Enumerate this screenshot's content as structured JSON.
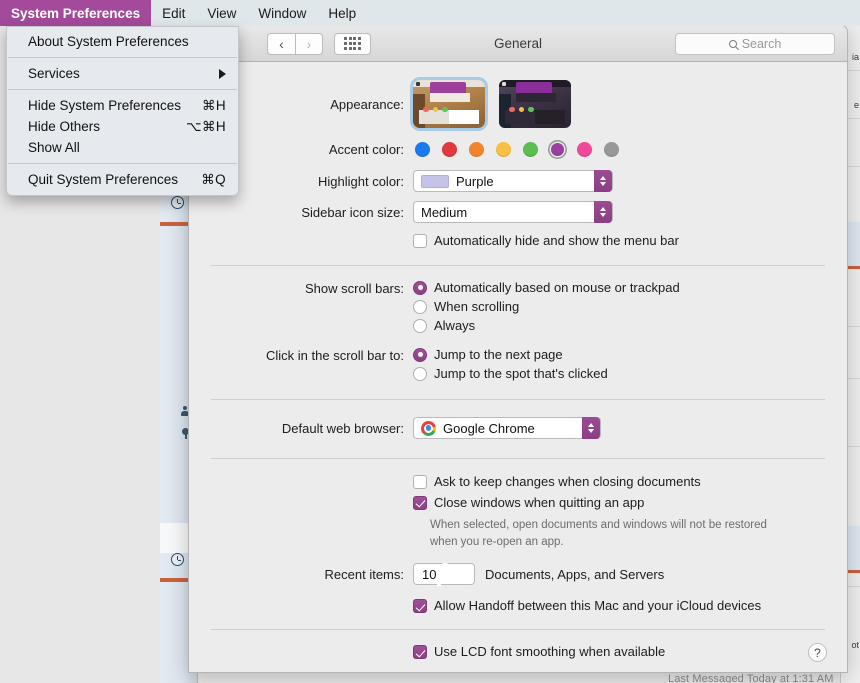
{
  "menubar": {
    "items": [
      {
        "label": "System Preferences",
        "active": true,
        "bold": true
      },
      {
        "label": "Edit",
        "active": false,
        "bold": false
      },
      {
        "label": "View",
        "active": false,
        "bold": false
      },
      {
        "label": "Window",
        "active": false,
        "bold": false
      },
      {
        "label": "Help",
        "active": false,
        "bold": false
      }
    ],
    "highlight_color": "#a34a9a"
  },
  "dropdown": {
    "about": "About System Preferences",
    "services": "Services",
    "hide_app": "Hide System Preferences",
    "hide_app_shortcut": "⌘H",
    "hide_others": "Hide Others",
    "hide_others_shortcut": "⌥⌘H",
    "show_all": "Show All",
    "quit": "Quit System Preferences",
    "quit_shortcut": "⌘Q"
  },
  "toolbar": {
    "title": "General",
    "back_glyph": "‹",
    "forward_glyph": "›",
    "search_placeholder": "Search",
    "search_value": ""
  },
  "general": {
    "appearance_label": "Appearance:",
    "appearance_options": [
      {
        "name": "Light",
        "selected": true
      },
      {
        "name": "Dark",
        "selected": false
      }
    ],
    "accent_label": "Accent color:",
    "accent_colors": [
      {
        "name": "Blue",
        "hex": "#1a7af0",
        "selected": false
      },
      {
        "name": "Red",
        "hex": "#e0393e",
        "selected": false
      },
      {
        "name": "Orange",
        "hex": "#f2842c",
        "selected": false
      },
      {
        "name": "Yellow",
        "hex": "#f6c044",
        "selected": false
      },
      {
        "name": "Green",
        "hex": "#5bbf4f",
        "selected": false
      },
      {
        "name": "Purple",
        "hex": "#9a3fa0",
        "selected": true
      },
      {
        "name": "Pink",
        "hex": "#f0499a",
        "selected": false
      },
      {
        "name": "Graphite",
        "hex": "#989898",
        "selected": false
      }
    ],
    "highlight_label": "Highlight color:",
    "highlight_value": "Purple",
    "highlight_swatch": "#c5c3e8",
    "sidebar_label": "Sidebar icon size:",
    "sidebar_value": "Medium",
    "autohide_menubar": {
      "label": "Automatically hide and show the menu bar",
      "checked": false
    },
    "scrollbars_label": "Show scroll bars:",
    "scrollbars_options": [
      {
        "label": "Automatically based on mouse or trackpad",
        "selected": true
      },
      {
        "label": "When scrolling",
        "selected": false
      },
      {
        "label": "Always",
        "selected": false
      }
    ],
    "clickscroll_label": "Click in the scroll bar to:",
    "clickscroll_options": [
      {
        "label": "Jump to the next page",
        "selected": true
      },
      {
        "label": "Jump to the spot that's clicked",
        "selected": false
      }
    ],
    "browser_label": "Default web browser:",
    "browser_value": "Google Chrome",
    "ask_keep_changes": {
      "label": "Ask to keep changes when closing documents",
      "checked": false
    },
    "close_windows": {
      "label": "Close windows when quitting an app",
      "checked": true
    },
    "close_windows_hint_1": "When selected, open documents and windows will not be restored",
    "close_windows_hint_2": "when you re-open an app.",
    "recent_items_label": "Recent items:",
    "recent_items_value": "10",
    "recent_items_suffix": "Documents, Apps, and Servers",
    "handoff": {
      "label": "Allow Handoff between this Mac and your iCloud devices",
      "checked": true
    },
    "lcd_smoothing": {
      "label": "Use LCD font smoothing when available",
      "checked": true
    },
    "help_glyph": "?"
  },
  "background": {
    "bottom_text": "Last Messaged  Today at 1:31 AM",
    "rule_color": "#c9613d"
  }
}
